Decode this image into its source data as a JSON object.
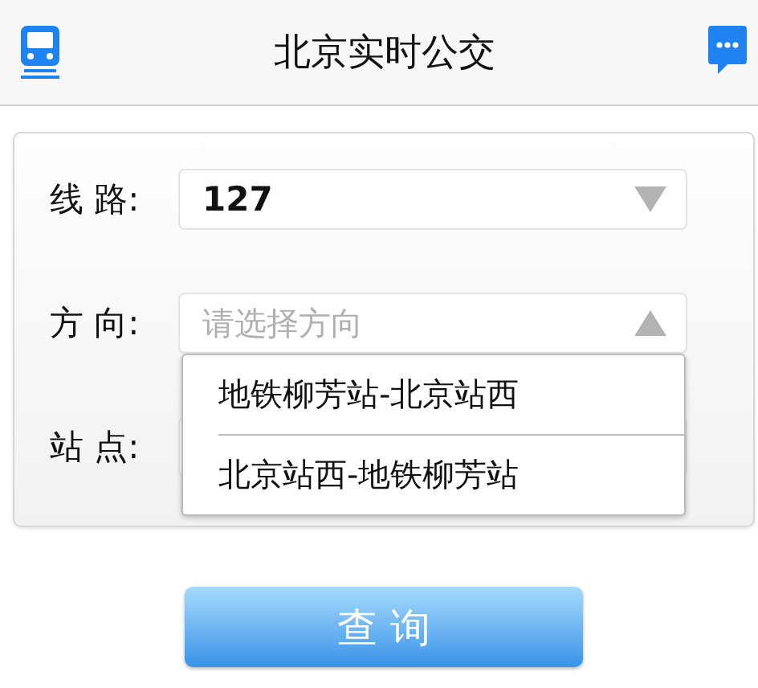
{
  "header": {
    "title": "北京实时公交"
  },
  "form": {
    "fields": [
      {
        "label": "线 路:",
        "value": "127",
        "expanded": false
      },
      {
        "label": "方 向:",
        "placeholder": "请选择方向",
        "expanded": true,
        "options": [
          {
            "label": "地铁柳芳站-北京站西"
          },
          {
            "label": "北京站西-地铁柳芳站"
          }
        ]
      },
      {
        "label": "站 点:"
      }
    ]
  },
  "query_button": {
    "label": "查 询"
  }
}
